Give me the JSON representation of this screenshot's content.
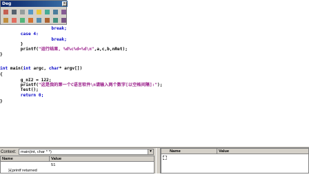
{
  "toolbar": {
    "title": "Deg",
    "close_glyph": "×",
    "buttons": [
      "restart-icon",
      "stop-icon",
      "break-icon",
      "apply-code-changes-icon",
      "show-next-statement-icon",
      "step-into-icon",
      "step-over-icon",
      "step-out-icon",
      "run-to-cursor-icon",
      "quickwatch-icon",
      "watch-icon",
      "variables-icon",
      "registers-icon",
      "memory-icon",
      "call-stack-icon",
      "disassembly-icon"
    ]
  },
  "editor": {
    "lines": [
      [
        {
          "t": "                    break;",
          "c": "kw"
        }
      ],
      [
        {
          "t": "        case 4:",
          "c": "kw"
        }
      ],
      [
        {
          "t": "                    break;",
          "c": "kw"
        }
      ],
      [
        {
          "t": "        }",
          "c": "plain"
        }
      ],
      [
        {
          "t": "        printf(",
          "c": "plain"
        },
        {
          "t": "\"运行结果, %d%c%d=%d\\n\"",
          "c": "str"
        },
        {
          "t": ",a,c,b,nRet);",
          "c": "plain"
        }
      ],
      [
        {
          "t": "}",
          "c": "plain"
        }
      ],
      [
        {
          "t": "",
          "c": "plain"
        }
      ],
      [
        {
          "t": "int",
          "c": "kw"
        },
        {
          "t": " main(",
          "c": "plain"
        },
        {
          "t": "int",
          "c": "kw"
        },
        {
          "t": " argc, ",
          "c": "plain"
        },
        {
          "t": "char",
          "c": "kw"
        },
        {
          "t": "* argv[])",
          "c": "plain"
        }
      ],
      [
        {
          "t": "{",
          "c": "plain"
        }
      ],
      [
        {
          "t": "        g_nI2 = 122;",
          "c": "plain"
        }
      ],
      [
        {
          "t": "        printf(",
          "c": "plain"
        },
        {
          "t": "\"这是我的第一个C语言软件\\n请输入两个数字[以空格间隔]:\"",
          "c": "str"
        },
        {
          "t": ");",
          "c": "plain"
        }
      ],
      [
        {
          "t": "        Test();",
          "c": "plain"
        }
      ],
      [
        {
          "t": "        return 0;",
          "c": "kw"
        }
      ],
      [
        {
          "t": "}",
          "c": "plain"
        }
      ]
    ]
  },
  "context": {
    "label": "Context:",
    "value": "main(int, char * *)"
  },
  "auto_vars": {
    "headers": [
      "Name",
      "Value"
    ],
    "rows": [
      {
        "name": "printf returned",
        "value": "51"
      }
    ]
  },
  "watch": {
    "headers": [
      "Name",
      "Value"
    ]
  },
  "colors": {
    "keyword": "#0000c8",
    "string": "#9a1f8a",
    "panel": "#d4d0c8"
  }
}
